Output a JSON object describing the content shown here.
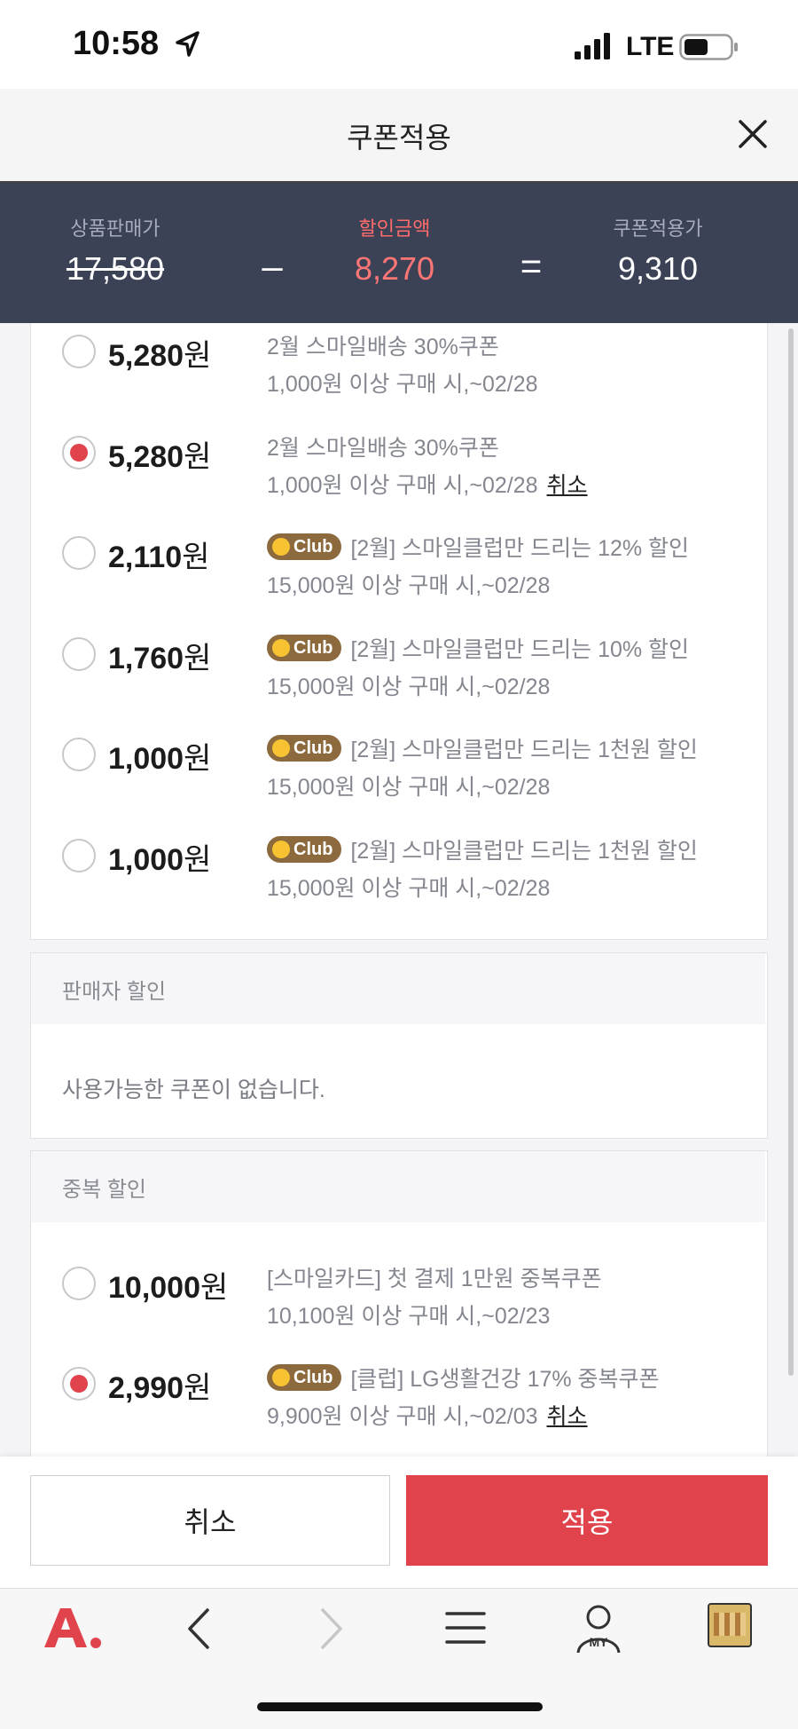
{
  "status_bar": {
    "time": "10:58",
    "network": "LTE"
  },
  "header": {
    "title": "쿠폰적용"
  },
  "summary": {
    "original_label": "상품판매가",
    "original_value": "17,580",
    "discount_label": "할인금액",
    "discount_value": "8,270",
    "final_label": "쿠폰적용가",
    "final_value": "9,310",
    "minus": "–",
    "equals": "="
  },
  "coupons": [
    {
      "amount": "5,280",
      "unit": "원",
      "selected": false,
      "club": false,
      "title": "2월 스마일배송 30%쿠폰",
      "condition": "1,000원 이상 구매 시,~02/28"
    },
    {
      "amount": "5,280",
      "unit": "원",
      "selected": true,
      "club": false,
      "title": "2월 스마일배송 30%쿠폰",
      "condition": "1,000원 이상 구매 시,~02/28",
      "cancel": "취소"
    },
    {
      "amount": "2,110",
      "unit": "원",
      "selected": false,
      "club": true,
      "title": "[2월] 스마일클럽만 드리는 12% 할인",
      "condition": "15,000원 이상 구매 시,~02/28"
    },
    {
      "amount": "1,760",
      "unit": "원",
      "selected": false,
      "club": true,
      "title": "[2월] 스마일클럽만 드리는 10% 할인",
      "condition": "15,000원 이상 구매 시,~02/28"
    },
    {
      "amount": "1,000",
      "unit": "원",
      "selected": false,
      "club": true,
      "title": "[2월] 스마일클럽만 드리는 1천원 할인",
      "condition": "15,000원 이상 구매 시,~02/28"
    },
    {
      "amount": "1,000",
      "unit": "원",
      "selected": false,
      "club": true,
      "title": "[2월] 스마일클럽만 드리는 1천원 할인",
      "condition": "15,000원 이상 구매 시,~02/28"
    }
  ],
  "club_badge": "Club",
  "seller_section": {
    "title": "판매자 할인",
    "empty_message": "사용가능한 쿠폰이 없습니다."
  },
  "duplicate_section": {
    "title": "중복 할인",
    "coupons": [
      {
        "amount": "10,000",
        "unit": "원",
        "selected": false,
        "club": false,
        "title": "[스마일카드] 첫 결제 1만원 중복쿠폰",
        "condition": "10,100원 이상 구매 시,~02/23"
      },
      {
        "amount": "2,990",
        "unit": "원",
        "selected": true,
        "club": true,
        "title": "[클럽] LG생활건강 17% 중복쿠폰",
        "condition": "9,900원 이상 구매 시,~02/03",
        "cancel": "취소"
      }
    ]
  },
  "actions": {
    "cancel": "취소",
    "apply": "적용"
  },
  "bottom_nav": {
    "my_label": "MY"
  },
  "colors": {
    "accent": "#e0434b",
    "summary_bg": "#3b4256",
    "club_badge": "#8c6a3e"
  }
}
